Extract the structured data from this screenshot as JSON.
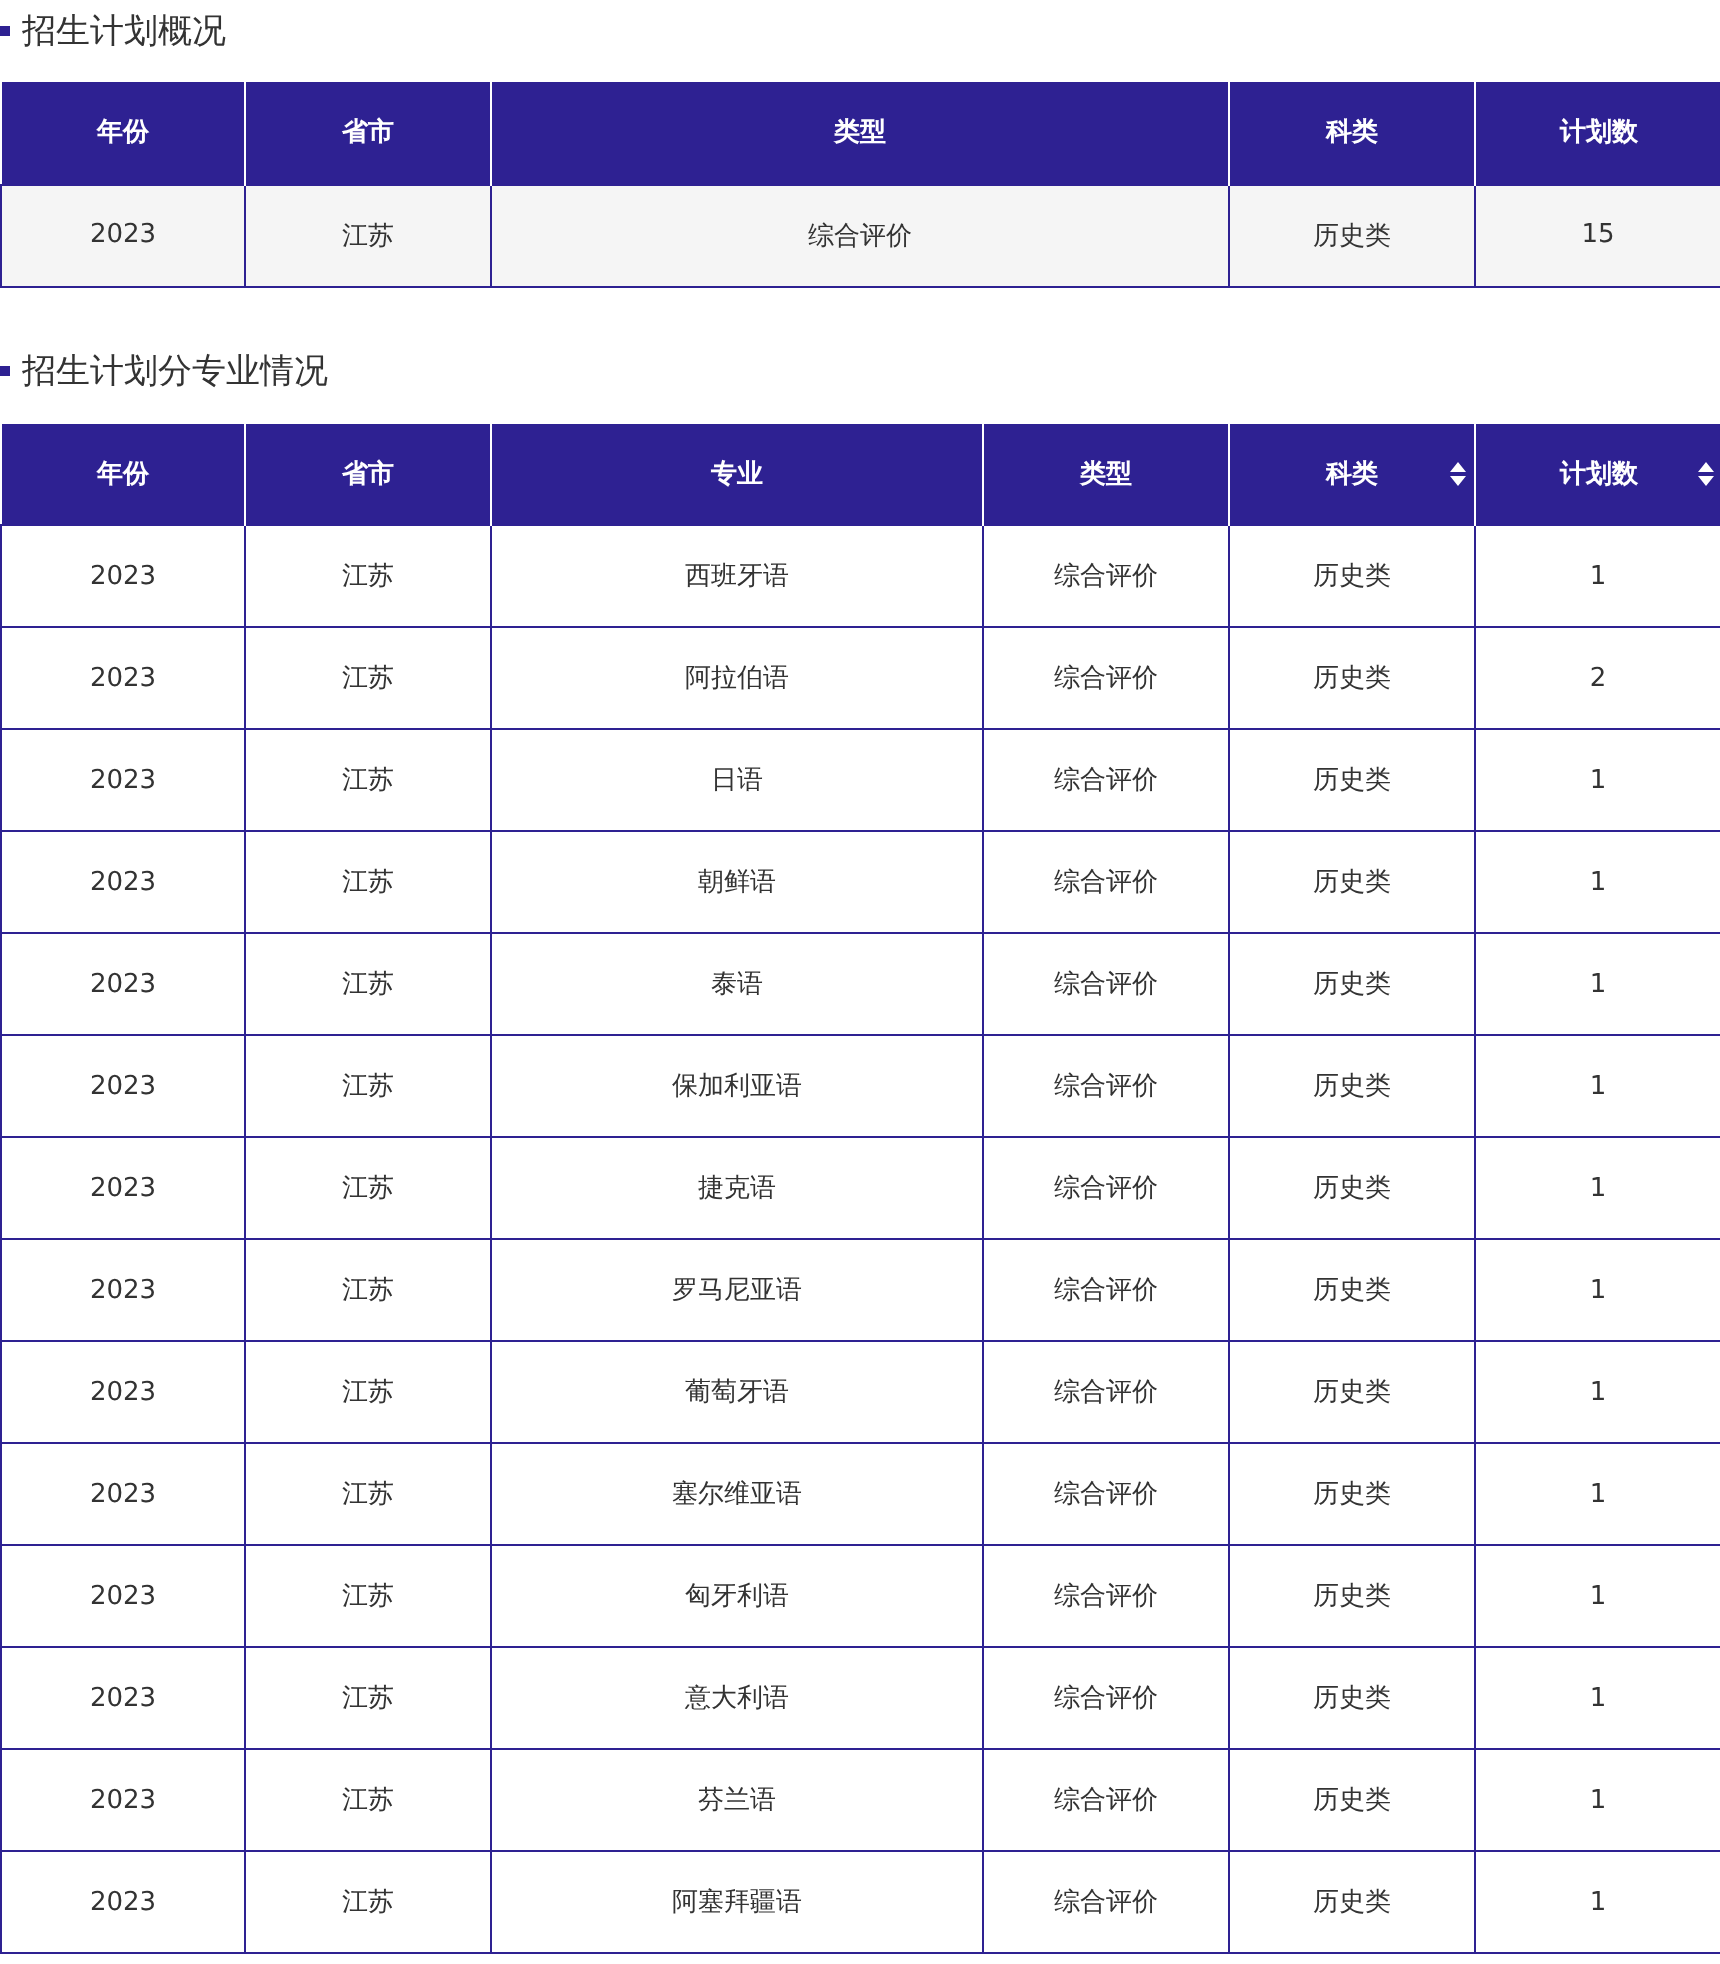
{
  "sections": [
    {
      "title": "招生计划概况",
      "columns": [
        {
          "label": "年份",
          "sortable": false
        },
        {
          "label": "省市",
          "sortable": false
        },
        {
          "label": "类型",
          "sortable": false
        },
        {
          "label": "科类",
          "sortable": false
        },
        {
          "label": "计划数",
          "sortable": false
        }
      ],
      "rows": [
        [
          "2023",
          "江苏",
          "综合评价",
          "历史类",
          "15"
        ]
      ]
    },
    {
      "title": "招生计划分专业情况",
      "columns": [
        {
          "label": "年份",
          "sortable": false
        },
        {
          "label": "省市",
          "sortable": false
        },
        {
          "label": "专业",
          "sortable": false
        },
        {
          "label": "类型",
          "sortable": false
        },
        {
          "label": "科类",
          "sortable": true
        },
        {
          "label": "计划数",
          "sortable": true
        }
      ],
      "rows": [
        [
          "2023",
          "江苏",
          "西班牙语",
          "综合评价",
          "历史类",
          "1"
        ],
        [
          "2023",
          "江苏",
          "阿拉伯语",
          "综合评价",
          "历史类",
          "2"
        ],
        [
          "2023",
          "江苏",
          "日语",
          "综合评价",
          "历史类",
          "1"
        ],
        [
          "2023",
          "江苏",
          "朝鲜语",
          "综合评价",
          "历史类",
          "1"
        ],
        [
          "2023",
          "江苏",
          "泰语",
          "综合评价",
          "历史类",
          "1"
        ],
        [
          "2023",
          "江苏",
          "保加利亚语",
          "综合评价",
          "历史类",
          "1"
        ],
        [
          "2023",
          "江苏",
          "捷克语",
          "综合评价",
          "历史类",
          "1"
        ],
        [
          "2023",
          "江苏",
          "罗马尼亚语",
          "综合评价",
          "历史类",
          "1"
        ],
        [
          "2023",
          "江苏",
          "葡萄牙语",
          "综合评价",
          "历史类",
          "1"
        ],
        [
          "2023",
          "江苏",
          "塞尔维亚语",
          "综合评价",
          "历史类",
          "1"
        ],
        [
          "2023",
          "江苏",
          "匈牙利语",
          "综合评价",
          "历史类",
          "1"
        ],
        [
          "2023",
          "江苏",
          "意大利语",
          "综合评价",
          "历史类",
          "1"
        ],
        [
          "2023",
          "江苏",
          "芬兰语",
          "综合评价",
          "历史类",
          "1"
        ],
        [
          "2023",
          "江苏",
          "阿塞拜疆语",
          "综合评价",
          "历史类",
          "1"
        ]
      ]
    }
  ]
}
